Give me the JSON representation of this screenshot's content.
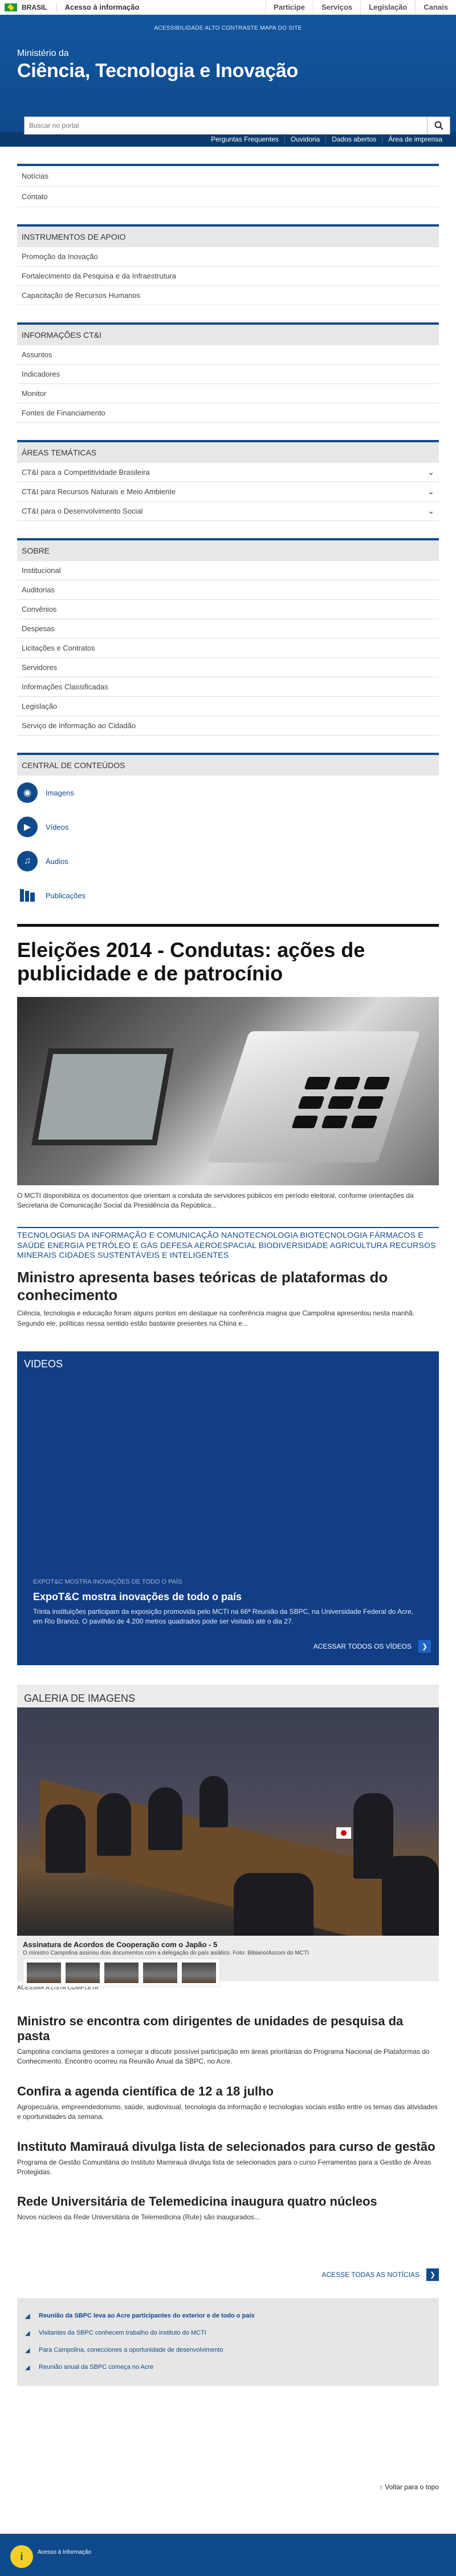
{
  "govbar": {
    "country": "BRASIL",
    "access": "Acesso à informação",
    "links": [
      "Participe",
      "Serviços",
      "Legislação",
      "Canais"
    ]
  },
  "header": {
    "accessibility": "ACESSIBILIDADE   ALTO CONTRASTE   MAPA DO SITE",
    "pre": "Ministério da",
    "title": "Ciência, Tecnologia e Inovação",
    "search_placeholder": "Buscar no portal"
  },
  "topnav": [
    "Perguntas Frequentes",
    "Ouvidoria",
    "Dados abertos",
    "Área de imprensa"
  ],
  "menu": {
    "main": [
      "Notícias",
      "Contato"
    ],
    "sections": [
      {
        "head": "INSTRUMENTOS DE APOIO",
        "items": [
          "Promoção da Inovação",
          "Fortalecimento da Pesquisa e da Infraestrutura",
          "Capacitação de Recursos Humanos"
        ]
      },
      {
        "head": "INFORMAÇÕES CT&I",
        "items": [
          "Assuntos",
          "Indicadores",
          "Monitor",
          "Fontes de Financiamento"
        ]
      },
      {
        "head": "ÁREAS TEMÁTICAS",
        "items": [
          "CT&I para a Competitividade Brasileira",
          "CT&I para Recursos Naturais e Meio Ambiente",
          "CT&I para o Desenvolvimento Social"
        ]
      },
      {
        "head": "SOBRE",
        "items": [
          "Institucional",
          "Auditorias",
          "Convênios",
          "Despesas",
          "Licitações e Contratos",
          "Servidores",
          "Informações Classificadas",
          "Legislação",
          "Serviço de Informação ao Cidadão"
        ]
      },
      {
        "head": "CENTRAL DE CONTEÚDOS",
        "items": [
          "Imagens",
          "Vídeos",
          "Áudios",
          "Publicações"
        ]
      }
    ]
  },
  "lead": {
    "title": "Eleições 2014 - Condutas: ações de publicidade e de patrocínio",
    "caption": "O MCTI disponibiliza os documentos que orientam a conduta de servidores públicos em período eleitoral, conforme orientações da Secretaria de Comunicação Social da Presidência da República..."
  },
  "tags": "TECNOLOGIAS DA INFORMAÇÃO E COMUNICAÇÃO  NANOTECNOLOGIA  BIOTECNOLOGIA  FÁRMACOS E SAÚDE  ENERGIA  PETRÓLEO E GÁS  DEFESA  AEROESPACIAL  BIODIVERSIDADE  AGRICULTURA  RECURSOS MINERAIS  CIDADES SUSTENTÁVEIS E INTELIGENTES",
  "news2": {
    "title": "Ministro apresenta bases teóricas de plataformas do conhecimento",
    "text": "Ciência, tecnologia e educação foram alguns pontos em destaque na conferência magna que Campolina apresentou nesta manhã. Segundo ele, políticas nessa sentido estão bastante presentes na China e..."
  },
  "videos": {
    "heading": "VIDEOS",
    "kicker": "EXPOT&C MOSTRA INOVAÇÕES DE TODO O PAÍS",
    "title": "ExpoT&C mostra inovações de todo o país",
    "text": "Trinta instituições participam da exposição promovida pelo MCTI na 66ª Reunião da SBPC, na Universidade Federal do Acre, em Rio Branco. O pavilhão de 4.200 metros quadrados pode ser visitado até o dia 27.",
    "more": "ACESSAR TODOS OS VÍDEOS"
  },
  "gallery": {
    "heading": "GALERIA DE IMAGENS",
    "caption": "Assinatura de Acordos de Cooperação com o Japão - 5",
    "caption2": "O ministro Campolina assinou dois documentos com a delegação do país asiático. Foto: Bibiano/Ascom do MCTI",
    "link": "ACESSAR A LISTA COMPLETA"
  },
  "news": [
    {
      "title": "Ministro se encontra com dirigentes de unidades de pesquisa da pasta",
      "text": "Campolina conclama gestores a começar a discutir possível participação em áreas prioritárias do Programa Nacional de Plataformas do Conhecimento. Encontro ocorreu na Reunião Anual da SBPC, no Acre."
    },
    {
      "title": "Confira a agenda científica de 12 a 18 julho",
      "text": "Agropecuária, empreendedorismo, saúde, audiovisual, tecnologia da informação e tecnologias sociais estão entre os temas das atividades e oportunidades da semana."
    },
    {
      "title": "Instituto Mamirauá divulga lista de selecionados para curso de gestão",
      "text": "Programa de Gestão Comunitária do Instituto Mamirauá divulga lista de selecionados para o curso Ferramentas para a Gestão de Áreas Protegidas."
    },
    {
      "title": "Rede Universitária de Telemedicina inaugura quatro núcleos",
      "text": "Novos núcleos da Rede Universitária de Telemedicina (Rute) são inaugurados..."
    }
  ],
  "all_news": "ACESSE TODAS AS NOTÍCIAS",
  "audio": [
    "Reunião da SBPC leva ao Acre participantes do exterior e de todo o país",
    "Visitantes da SBPC conhecem trabalho do instituto do MCTI",
    "Para Campolina, conecciones a oportunidade de desenvolvimento",
    "Reunião anual da SBPC começa no Acre"
  ],
  "back_top": "Voltar para o topo",
  "footer": {
    "ai": "Acesso à Informação"
  }
}
